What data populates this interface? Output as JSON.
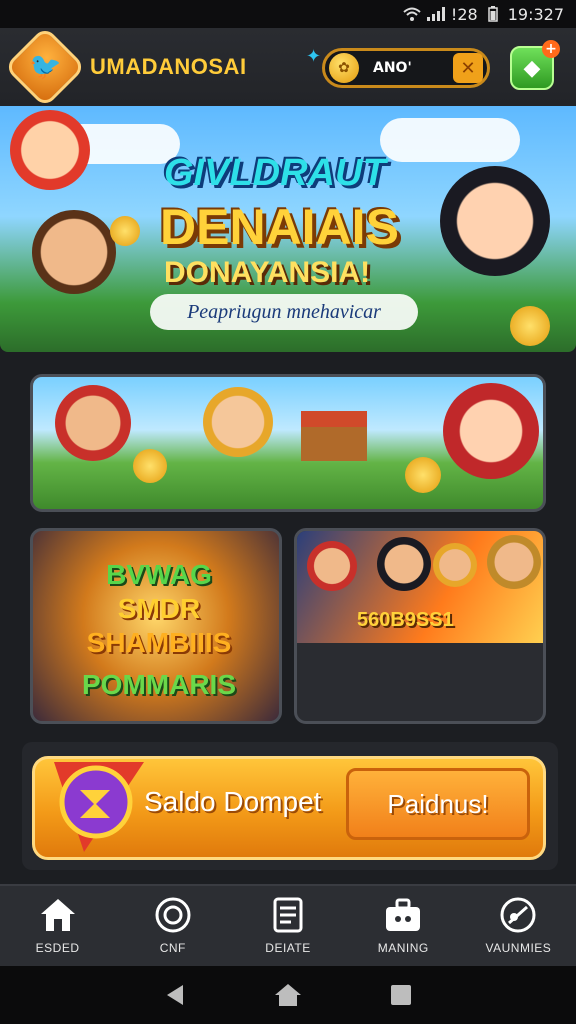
{
  "status_bar": {
    "time": "19:327",
    "signal": "!28"
  },
  "header": {
    "app_title": "UMADANOSAI",
    "coin_balance": "ANO'",
    "coin_add_symbol": "✕",
    "gift_badge": "+"
  },
  "hero": {
    "line1": "GIVLDRAUT",
    "line2": "DENAIAIS",
    "line3": "DONAYANSIA!",
    "subtitle": "Peapriugun mnehavicar"
  },
  "cards": {
    "wide": {},
    "left": {
      "line1": "SMDR",
      "line2": "SHAMBIIIS",
      "line3": "POMMARIS",
      "top": "BVWAG"
    },
    "right": {
      "label": "560B9SS1"
    }
  },
  "wallet": {
    "label": "Saldo Dompet",
    "action": "Paidnus!"
  },
  "bottom_nav": [
    {
      "label": "ESDED",
      "icon": "home-icon"
    },
    {
      "label": "CNF",
      "icon": "target-icon"
    },
    {
      "label": "DEIATE",
      "icon": "receipt-icon"
    },
    {
      "label": "MANING",
      "icon": "toolbox-icon"
    },
    {
      "label": "VAUNMIES",
      "icon": "whistle-icon"
    }
  ],
  "colors": {
    "accent": "#f39a18",
    "gold": "#ffcc3a",
    "green": "#3fb52c",
    "background": "#1c1e22"
  }
}
